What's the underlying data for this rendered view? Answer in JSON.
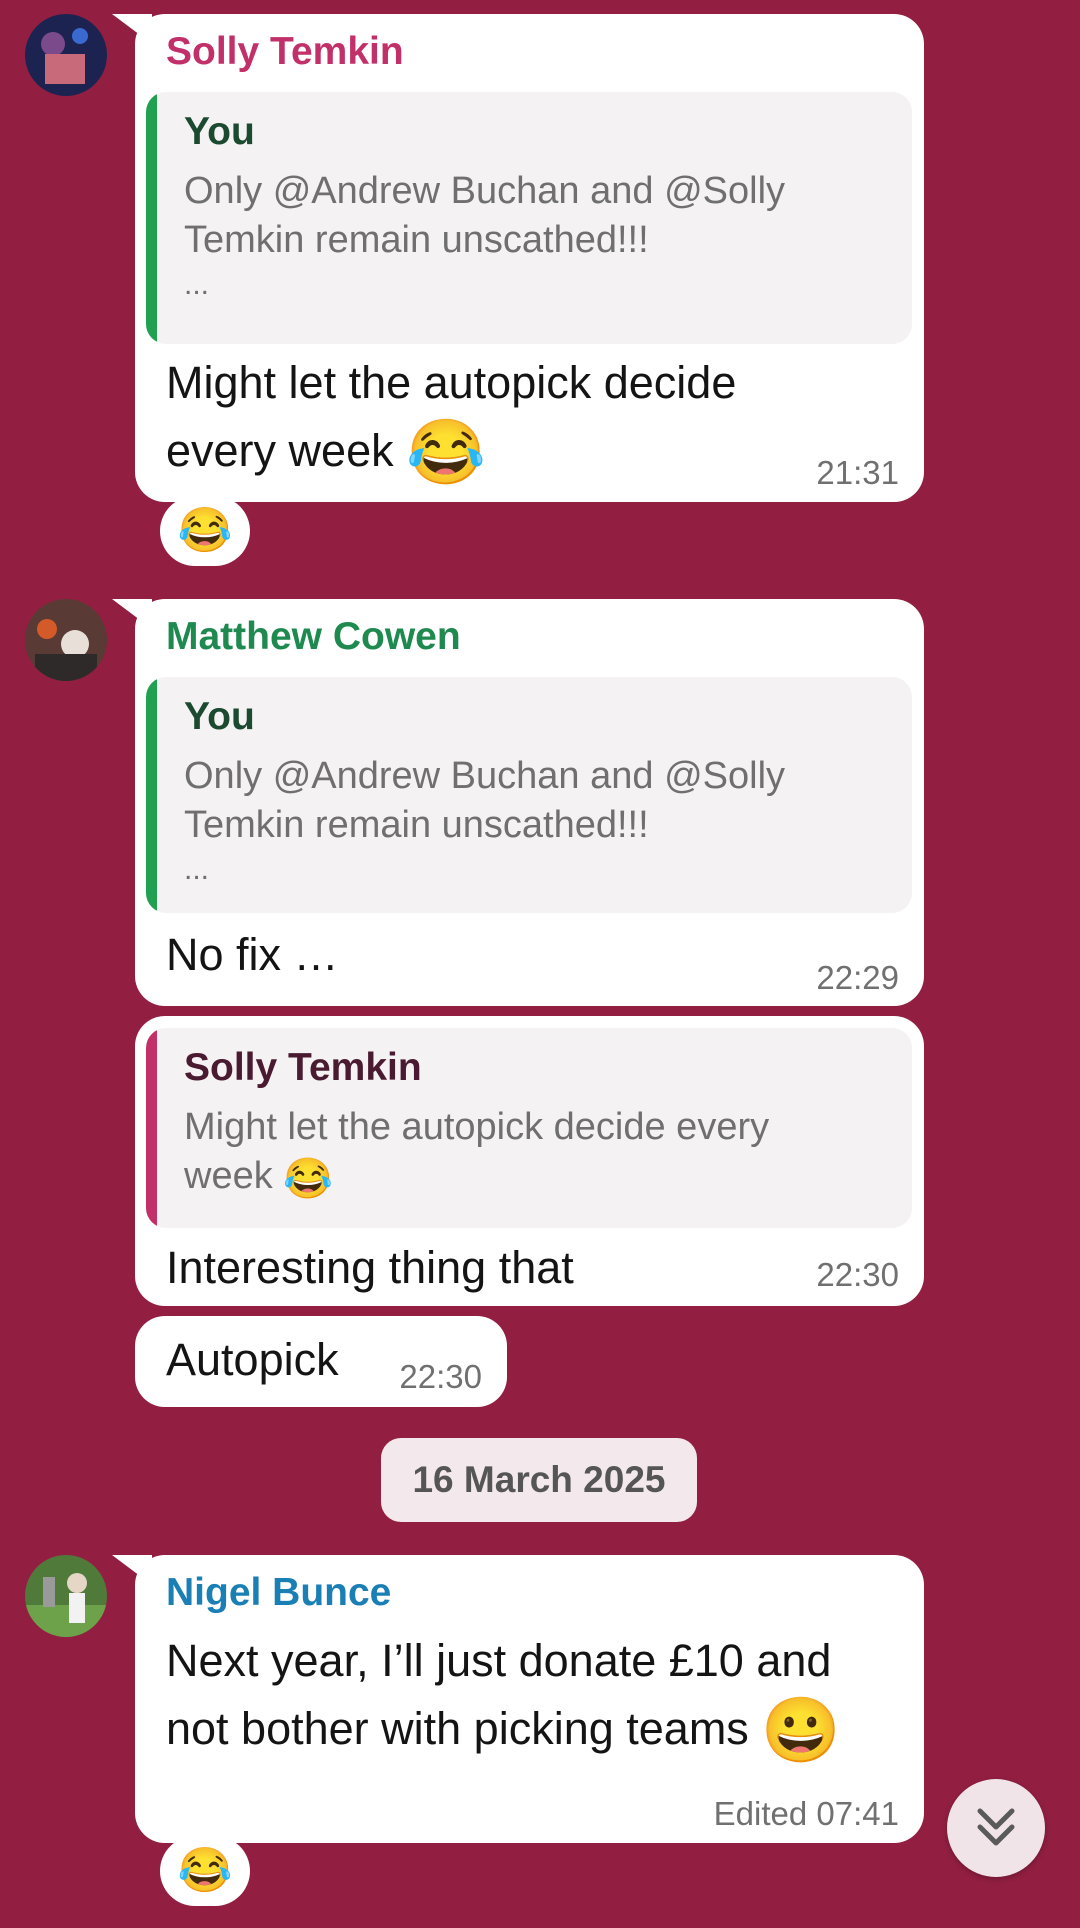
{
  "messages": [
    {
      "sender": "Solly Temkin",
      "sender_color": "#c2306a",
      "quote": {
        "name": "You",
        "name_color": "#1b4a31",
        "bar_color": "#21a052",
        "line1": "Only @Andrew Buchan and @Solly",
        "line2": "Temkin remain unscathed!!!",
        "line3": "..."
      },
      "text_line1": "Might let the autopick decide",
      "text_line2": "every week",
      "emoji": "😂",
      "time": "21:31",
      "reaction": "😂"
    },
    {
      "sender": "Matthew Cowen",
      "sender_color": "#1e8a4f",
      "quote": {
        "name": "You",
        "name_color": "#1b4a31",
        "bar_color": "#21a052",
        "line1": "Only @Andrew Buchan and @Solly",
        "line2": "Temkin remain unscathed!!!",
        "line3": "..."
      },
      "text": "No fix …",
      "time": "22:29"
    },
    {
      "quote": {
        "name": "Solly Temkin",
        "name_color": "#4a1a30",
        "bar_color": "#c2306a",
        "line1": "Might let the autopick decide every",
        "line2": "week",
        "emoji": "😂"
      },
      "text": "Interesting thing that",
      "time": "22:30"
    },
    {
      "text": "Autopick",
      "time": "22:30"
    },
    {
      "sender": "Nigel Bunce",
      "sender_color": "#1a7fb5",
      "text_line1": "Next year, I’ll just donate £10 and",
      "text_line2": "not bother with picking teams",
      "emoji": "😀",
      "time": "Edited 07:41",
      "reaction": "😂"
    }
  ],
  "date_separator": "16 March 2025",
  "background_color": "#921f42"
}
